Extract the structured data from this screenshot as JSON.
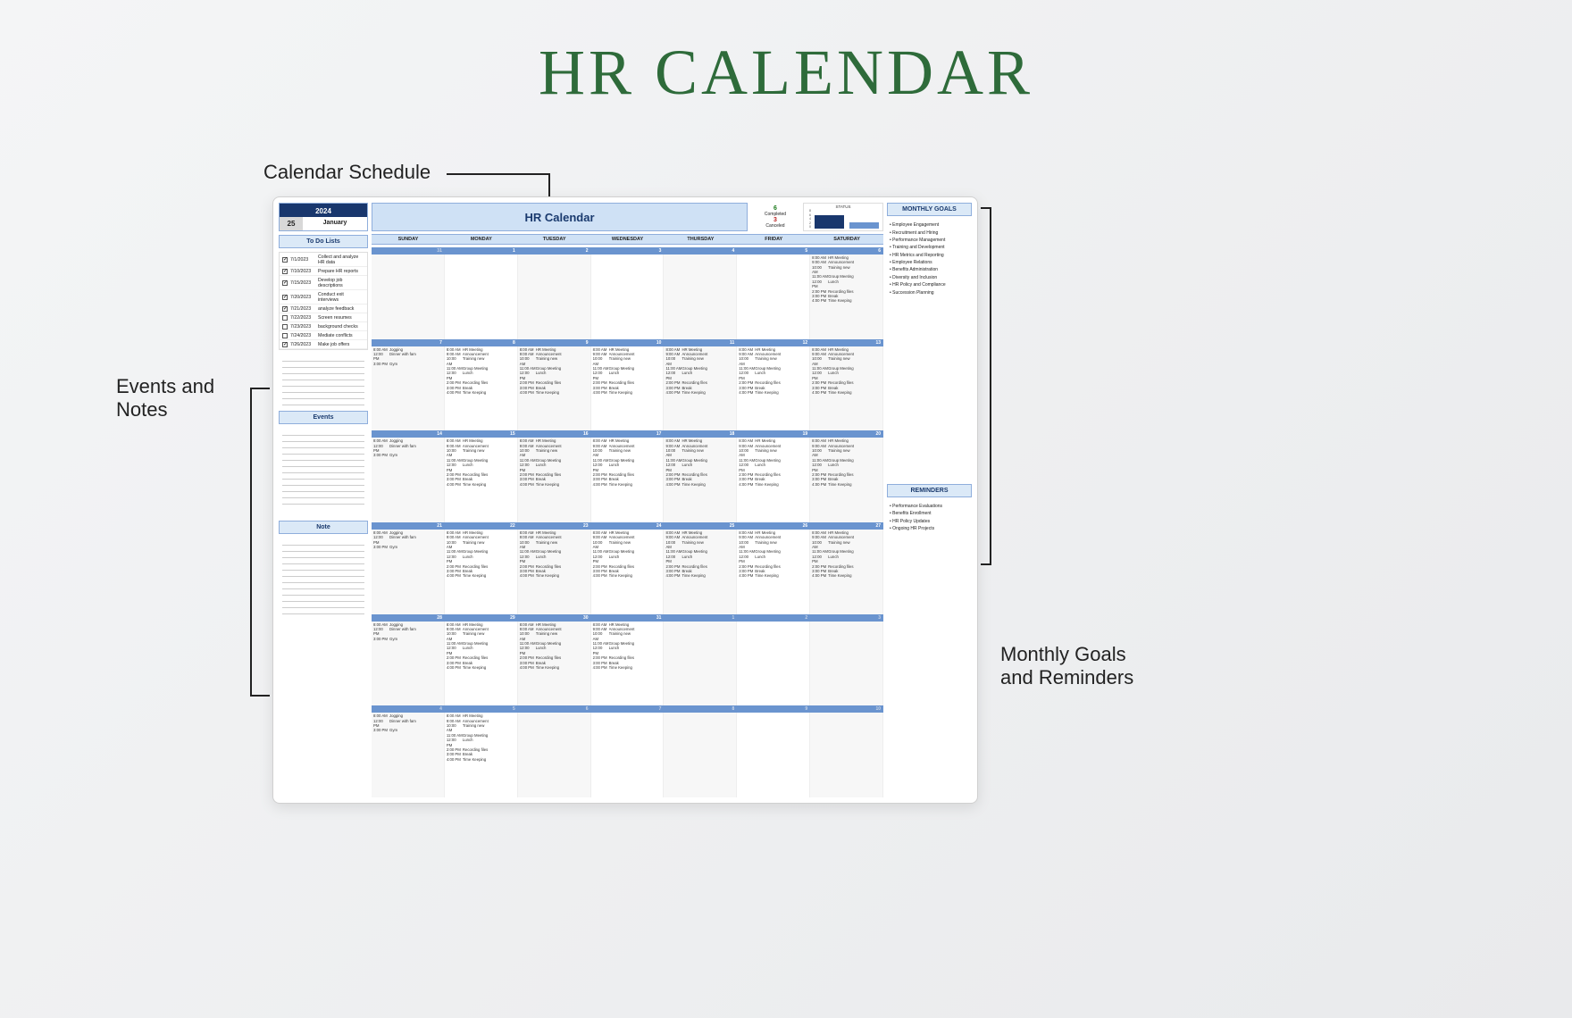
{
  "title": "HR CALENDAR",
  "annotations": {
    "schedule": "Calendar Schedule",
    "events_notes": "Events and\nNotes",
    "goals_reminders": "Monthly Goals\nand Reminders"
  },
  "left": {
    "year": "2024",
    "day": "25",
    "month": "January",
    "todo_header": "To Do Lists",
    "todos": [
      {
        "done": true,
        "date": "7/1/2023",
        "text": "Collect and analyze HR data"
      },
      {
        "done": true,
        "date": "7/10/2023",
        "text": "Prepare HR reports"
      },
      {
        "done": true,
        "date": "7/15/2023",
        "text": "Develop job descriptions"
      },
      {
        "done": true,
        "date": "7/20/2023",
        "text": "Conduct exit interviews"
      },
      {
        "done": true,
        "date": "7/21/2023",
        "text": "analyze feedback"
      },
      {
        "done": false,
        "date": "7/22/2023",
        "text": "Screen resumes"
      },
      {
        "done": false,
        "date": "7/23/2023",
        "text": "background checks"
      },
      {
        "done": false,
        "date": "7/24/2023",
        "text": "Mediate conflicts"
      },
      {
        "done": true,
        "date": "7/26/2023",
        "text": "Make job offers"
      }
    ],
    "events_header": "Events",
    "note_header": "Note"
  },
  "mid": {
    "cal_title": "HR Calendar",
    "completed_n": "6",
    "completed_l": "Completed",
    "canceled_n": "3",
    "canceled_l": "Canceled",
    "status_label": "STATUS",
    "day_headers": [
      "SUNDAY",
      "MONDAY",
      "TUESDAY",
      "WEDNESDAY",
      "THURSDAY",
      "FRIDAY",
      "SATURDAY"
    ],
    "sunday_schedule": [
      {
        "t": "8:00 AM",
        "n": "Jogging"
      },
      {
        "t": "",
        "n": ""
      },
      {
        "t": "",
        "n": ""
      },
      {
        "t": "12:00 PM",
        "n": "Dinner with fam"
      },
      {
        "t": "",
        "n": ""
      },
      {
        "t": "3:00 PM",
        "n": "Gym"
      }
    ],
    "daily_schedule": [
      {
        "t": "8:00 AM",
        "n": "HR Meeting"
      },
      {
        "t": "9:00 AM",
        "n": "Announcement"
      },
      {
        "t": "10:00 AM",
        "n": "Training new"
      },
      {
        "t": "11:00 AM",
        "n": "Group Meeting"
      },
      {
        "t": "12:00 PM",
        "n": "Lunch"
      },
      {
        "t": "2:00 PM",
        "n": "Recording files"
      },
      {
        "t": "3:00 PM",
        "n": "Break"
      },
      {
        "t": "4:00 PM",
        "n": "Time Keeping"
      }
    ],
    "weeks": [
      {
        "dates": [
          "31",
          "1",
          "2",
          "3",
          "4",
          "5",
          "6"
        ],
        "muted": [
          0
        ],
        "fill_from": 6
      },
      {
        "dates": [
          "7",
          "8",
          "9",
          "10",
          "11",
          "12",
          "13"
        ],
        "muted": [],
        "fill_from": 0
      },
      {
        "dates": [
          "14",
          "15",
          "16",
          "17",
          "18",
          "19",
          "20"
        ],
        "muted": [],
        "fill_from": 0
      },
      {
        "dates": [
          "21",
          "22",
          "23",
          "24",
          "25",
          "26",
          "27"
        ],
        "muted": [],
        "fill_from": 0
      },
      {
        "dates": [
          "28",
          "29",
          "30",
          "31",
          "1",
          "2",
          "3"
        ],
        "muted": [
          4,
          5,
          6
        ],
        "fill_from": 0
      },
      {
        "dates": [
          "4",
          "5",
          "6",
          "7",
          "8",
          "9",
          "10"
        ],
        "muted": [
          0,
          1,
          2,
          3,
          4,
          5,
          6
        ],
        "fill_from": 0,
        "fill_to": 1
      }
    ]
  },
  "right": {
    "goals_header": "MONTHLY GOALS",
    "goals": [
      "Employee Engagement",
      "Recruitment and Hiring",
      "Performance Management",
      "Training and Development",
      "HR Metrics and Reporting",
      "Employee Relations",
      "Benefits Administration",
      "Diversity and Inclusion",
      "HR Policy and Compliance",
      "Succession Planning"
    ],
    "rem_header": "REMINDERS",
    "reminders": [
      "Performance Evaluations",
      "Benefits Enrollment",
      "HR Policy Updates",
      "Ongoing HR Projects"
    ]
  },
  "chart_data": {
    "type": "bar",
    "title": "STATUS",
    "categories": [
      "Completed",
      "Canceled"
    ],
    "values": [
      6,
      3
    ],
    "ylabel": "",
    "ylim": [
      0,
      8
    ],
    "axis_ticks": [
      "8",
      "6",
      "4",
      "2",
      "0"
    ]
  }
}
